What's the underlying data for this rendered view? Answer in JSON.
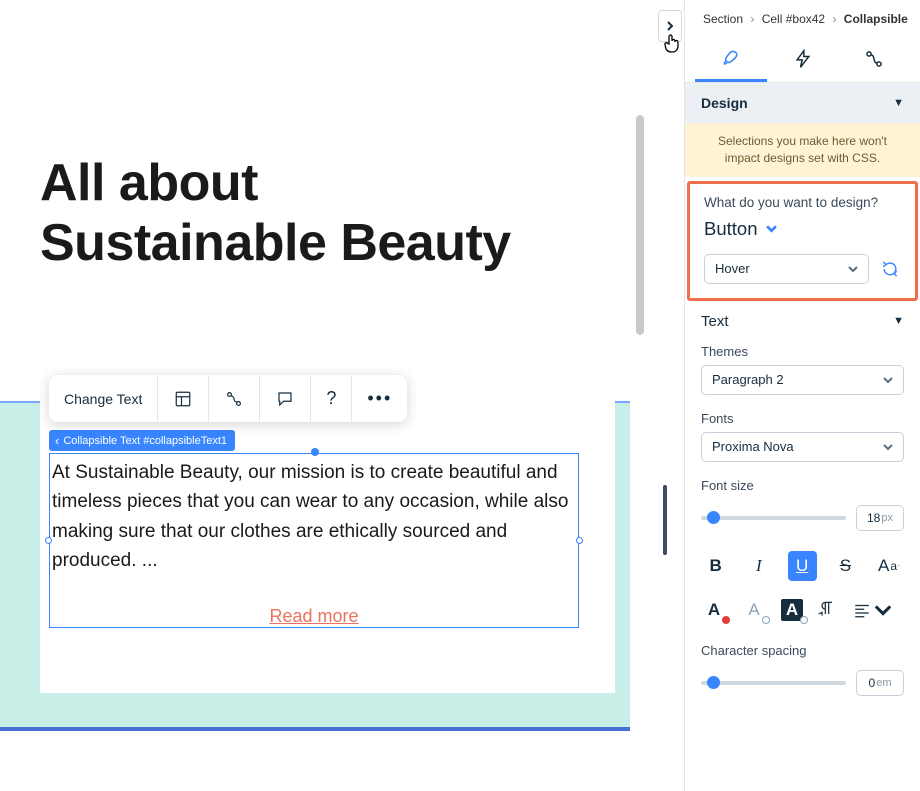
{
  "canvas": {
    "heading_l1": "All about",
    "heading_l2": "Sustainable Beauty",
    "toolbar": {
      "change_text": "Change Text",
      "icons": [
        "layout",
        "connections",
        "comment",
        "help",
        "more"
      ]
    },
    "selection_tag": "Collapsible Text #collapsibleText1",
    "body_text": "At Sustainable Beauty, our mission is to create beautiful and timeless pieces that you can wear to any occasion, while also making sure that our clothes are ethically sourced and produced. ...",
    "read_more": "Read more"
  },
  "panel": {
    "breadcrumb": [
      "Section",
      "Cell #box42",
      "Collapsible"
    ],
    "tabs": [
      "design",
      "animation",
      "dev"
    ],
    "active_tab": "design",
    "design_header": "Design",
    "css_note": "Selections you make here won't impact designs set with CSS.",
    "design_question": "What do you want to design?",
    "design_target": "Button",
    "state_select": "Hover",
    "accordion_text": "Text",
    "themes_label": "Themes",
    "themes_value": "Paragraph 2",
    "fonts_label": "Fonts",
    "fonts_value": "Proxima Nova",
    "font_size_label": "Font size",
    "font_size_value": "18",
    "font_size_unit": "px",
    "style_buttons": {
      "bold": "B",
      "italic": "I",
      "underline": "U",
      "strike": "S",
      "case_big": "A",
      "case_small": "a"
    },
    "color_letter": "A",
    "char_spacing_label": "Character spacing",
    "char_spacing_value": "0",
    "char_spacing_unit": "em"
  }
}
